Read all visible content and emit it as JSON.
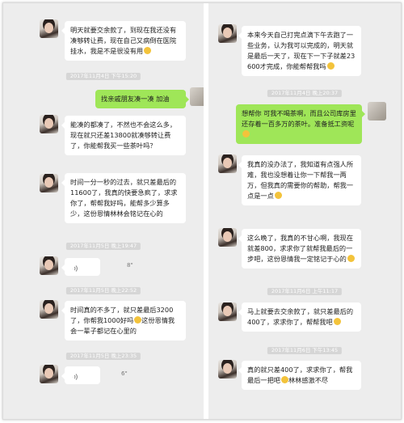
{
  "left": {
    "msg1": "明天就要交余款了，到现在我还没有凑够转让费，现在自己又病倒在医院挂水，我是不是很没有用",
    "ts1": "2017年11月4日 下午15:20",
    "green1": "找亲戚朋友凑一凑 加油",
    "msg2": "能凑的都凑了，不然也不会这么多，现在就只还差13800就凑够转让费了，你能帮我买一些茶叶吗？",
    "msg3": "时间一分一秒的过去，就只差最后的11600了，我真的快要急疯了，求求你了，帮帮我好吗，能帮多少算多少，这份恩情林林会铭记在心的",
    "ts2": "2017年11月5日 晚上19:47",
    "voice1": "8\"",
    "ts3": "2017年11月5日 晚上22:52",
    "msg4": "时间真的不多了，就只差最后3200了，你帮我1000好吗",
    "msg4b": "这份恩情我会一辈子都记在心里的",
    "ts4": "2017年11月5日 晚上23:35",
    "voice2": "6\""
  },
  "right": {
    "msg1": "本来今天自己打完点滴下午去跑了一些业务，认为我可以完成的，明天就是最后一天了，现在下一下子就差23600才完成，你能帮帮我吗",
    "ts1": "2017年11月4日 晚上20:37",
    "green1": "想帮你 可我不喝茶啊，而且公司库房里还存着一百多万的茶叶。准备抵工资呢",
    "msg2": "我真的没办法了，我知道有点强人所难，我也没想着让你一下帮我一两万，但我真的需要你的帮助，帮我一点是一点",
    "msg3": "这么晚了，我真的不甘心啊，我现在就差800，求求你了就帮我最后的一步吧，这份恩情我一定铭记于心的",
    "ts2": "2017年11月6日 上午11:17",
    "msg4": "马上就要去交余款了，就只差最后的400了，求求你了，帮帮我吧",
    "ts3": "2017年11月6日 下午13:45",
    "msg5": "真的就只差400了，求求你了，帮我最后一把吧",
    "msg5b": "林林感激不尽"
  }
}
